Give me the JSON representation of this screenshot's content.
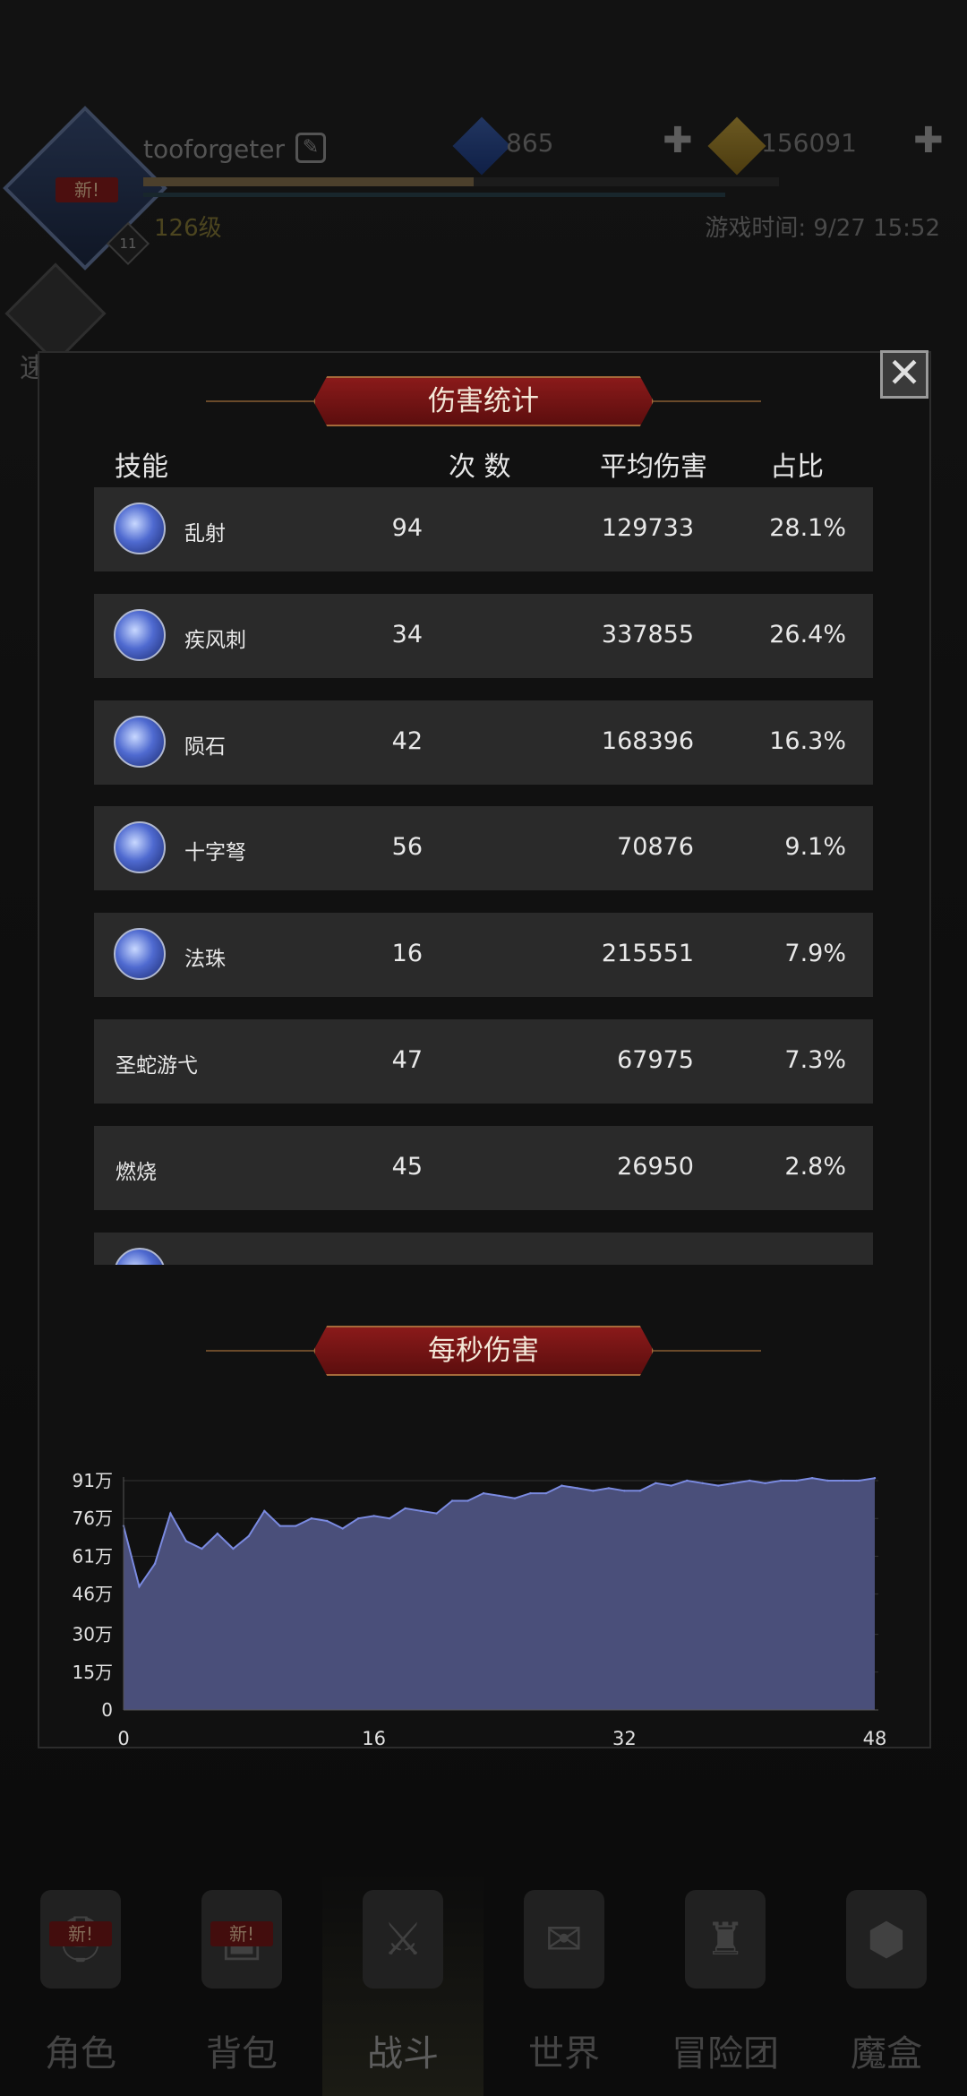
{
  "header": {
    "username": "tooforgeter",
    "level": "126级",
    "exp_progress": 0.52,
    "gems": "865",
    "gold": "156091",
    "game_time": "游戏时间: 9/27 15:52",
    "avatar_badge": "新!",
    "avatar_level_badge": "11",
    "speed_label": "速 战"
  },
  "modal": {
    "close_label": "✕",
    "damage_title": "伤害统计",
    "dps_title": "每秒伤害",
    "columns": {
      "skill": "技能",
      "count": "次 数",
      "avg": "平均伤害",
      "ratio": "占比"
    },
    "rows": [
      {
        "name": "乱射",
        "count": "94",
        "avg": "129733",
        "ratio": "28.1%",
        "icon": "volley-icon"
      },
      {
        "name": "疾风刺",
        "count": "34",
        "avg": "337855",
        "ratio": "26.4%",
        "icon": "gale-thrust-icon"
      },
      {
        "name": "陨石",
        "count": "42",
        "avg": "168396",
        "ratio": "16.3%",
        "icon": "meteor-icon"
      },
      {
        "name": "十字弩",
        "count": "56",
        "avg": "70876",
        "ratio": "9.1%",
        "icon": "crossbow-icon"
      },
      {
        "name": "法珠",
        "count": "16",
        "avg": "215551",
        "ratio": "7.9%",
        "icon": "magic-orb-icon"
      },
      {
        "name": "圣蛇游弋",
        "count": "47",
        "avg": "67975",
        "ratio": "7.3%",
        "icon": ""
      },
      {
        "name": "燃烧",
        "count": "45",
        "avg": "26950",
        "ratio": "2.8%",
        "icon": ""
      },
      {
        "name": "",
        "count": "",
        "avg": "",
        "ratio": "",
        "icon": "partial-skill-icon"
      }
    ]
  },
  "chart_data": {
    "type": "area",
    "title": "每秒伤害",
    "xlabel": "",
    "ylabel": "",
    "x_ticks": [
      "0",
      "16",
      "32",
      "48"
    ],
    "y_ticks": [
      "0",
      "15万",
      "30万",
      "46万",
      "61万",
      "76万",
      "91万"
    ],
    "xlim": [
      0,
      48
    ],
    "ylim": [
      0,
      91
    ],
    "grid": true,
    "color": "#4a4f7a",
    "line_color": "#7a8ae0",
    "x": [
      0,
      1,
      2,
      3,
      4,
      5,
      6,
      7,
      8,
      9,
      10,
      11,
      12,
      13,
      14,
      15,
      16,
      17,
      18,
      19,
      20,
      21,
      22,
      23,
      24,
      25,
      26,
      27,
      28,
      29,
      30,
      31,
      32,
      33,
      34,
      35,
      36,
      37,
      38,
      39,
      40,
      41,
      42,
      43,
      44,
      45,
      46,
      47,
      48
    ],
    "values": [
      73,
      49,
      58,
      78,
      67,
      64,
      70,
      64,
      69,
      79,
      73,
      73,
      76,
      75,
      72,
      76,
      77,
      76,
      80,
      79,
      78,
      83,
      83,
      86,
      85,
      84,
      86,
      86,
      89,
      88,
      87,
      88,
      87,
      87,
      90,
      89,
      91,
      90,
      89,
      90,
      91,
      90,
      91,
      91,
      92,
      91,
      91,
      91,
      92
    ]
  },
  "nav": {
    "items": [
      {
        "label": "角色",
        "icon": "helmet-icon",
        "badge": "新!"
      },
      {
        "label": "背包",
        "icon": "backpack-icon",
        "badge": "新!"
      },
      {
        "label": "战斗",
        "icon": "sword-shield-icon",
        "badge": ""
      },
      {
        "label": "世界",
        "icon": "map-scroll-icon",
        "badge": ""
      },
      {
        "label": "冒险团",
        "icon": "castle-icon",
        "badge": ""
      },
      {
        "label": "魔盒",
        "icon": "magic-cube-icon",
        "badge": ""
      }
    ]
  }
}
